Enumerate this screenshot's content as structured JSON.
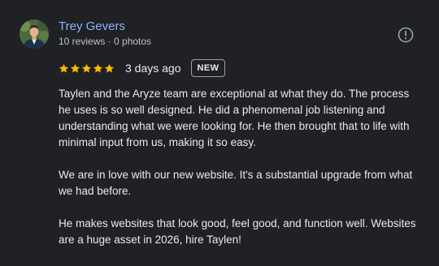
{
  "review": {
    "author": {
      "name": "Trey Gevers",
      "meta": "10 reviews · 0 photos",
      "avatar_icon": "user-avatar"
    },
    "report_icon": "report-icon",
    "rating": {
      "value": 5,
      "max": 5,
      "star_color": "#fbbc04"
    },
    "date": "3 days ago",
    "badge": "NEW",
    "paragraphs": [
      "Taylen and the Aryze team are exceptional at what they do. The process he uses is so well designed. He did a phenomenal job listening and understanding what we were looking for. He then brought that to life with minimal input from us, making it so easy.",
      "We are in love with our new website. It's a substantial upgrade from what we had before.",
      "He makes websites that look good, feel good, and function well. Websites are a huge asset in 2026, hire Taylen!"
    ]
  },
  "colors": {
    "background": "#202124",
    "link": "#8ab4f8",
    "text": "#e8eaed",
    "muted": "#bdc1c6"
  }
}
